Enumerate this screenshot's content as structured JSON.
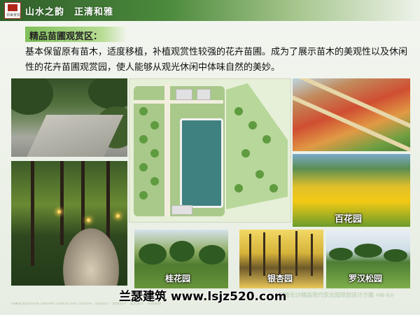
{
  "header": {
    "logo_text": "领美景观",
    "motto_part1": "山水之韵",
    "motto_part2": "正清和雅"
  },
  "section": {
    "title": "精品苗圃观赏区：",
    "paragraph": "基本保留原有苗木，适度移植，补植观赏性较强的花卉苗圃。成为了展示苗木的美观性以及休闲性的花卉苗圃观赏园，使人能够从观光休闲中体味自然的美妙。"
  },
  "photos": {
    "flower_garden_label": "百花园",
    "osmanthus_garden_label": "桂花园",
    "ginkgo_garden_label": "银杏园",
    "pine_garden_label": "罗汉松园"
  },
  "footer": {
    "project_title": "湖南长沙精品现代农业园规划设计方案",
    "location_tag": "中国·长沙",
    "note": "领美景观设计机构 LINGMEI LANDSCAPE DESIGN · 规划设计 · 景观设计 · 建筑设计 · 项目策划"
  },
  "watermark": "兰瑟建筑 www.lsjz520.com",
  "colors": {
    "header_dark": "#2f5e2a",
    "section_green": "#7fbf5a",
    "lake": "#3f8080"
  }
}
